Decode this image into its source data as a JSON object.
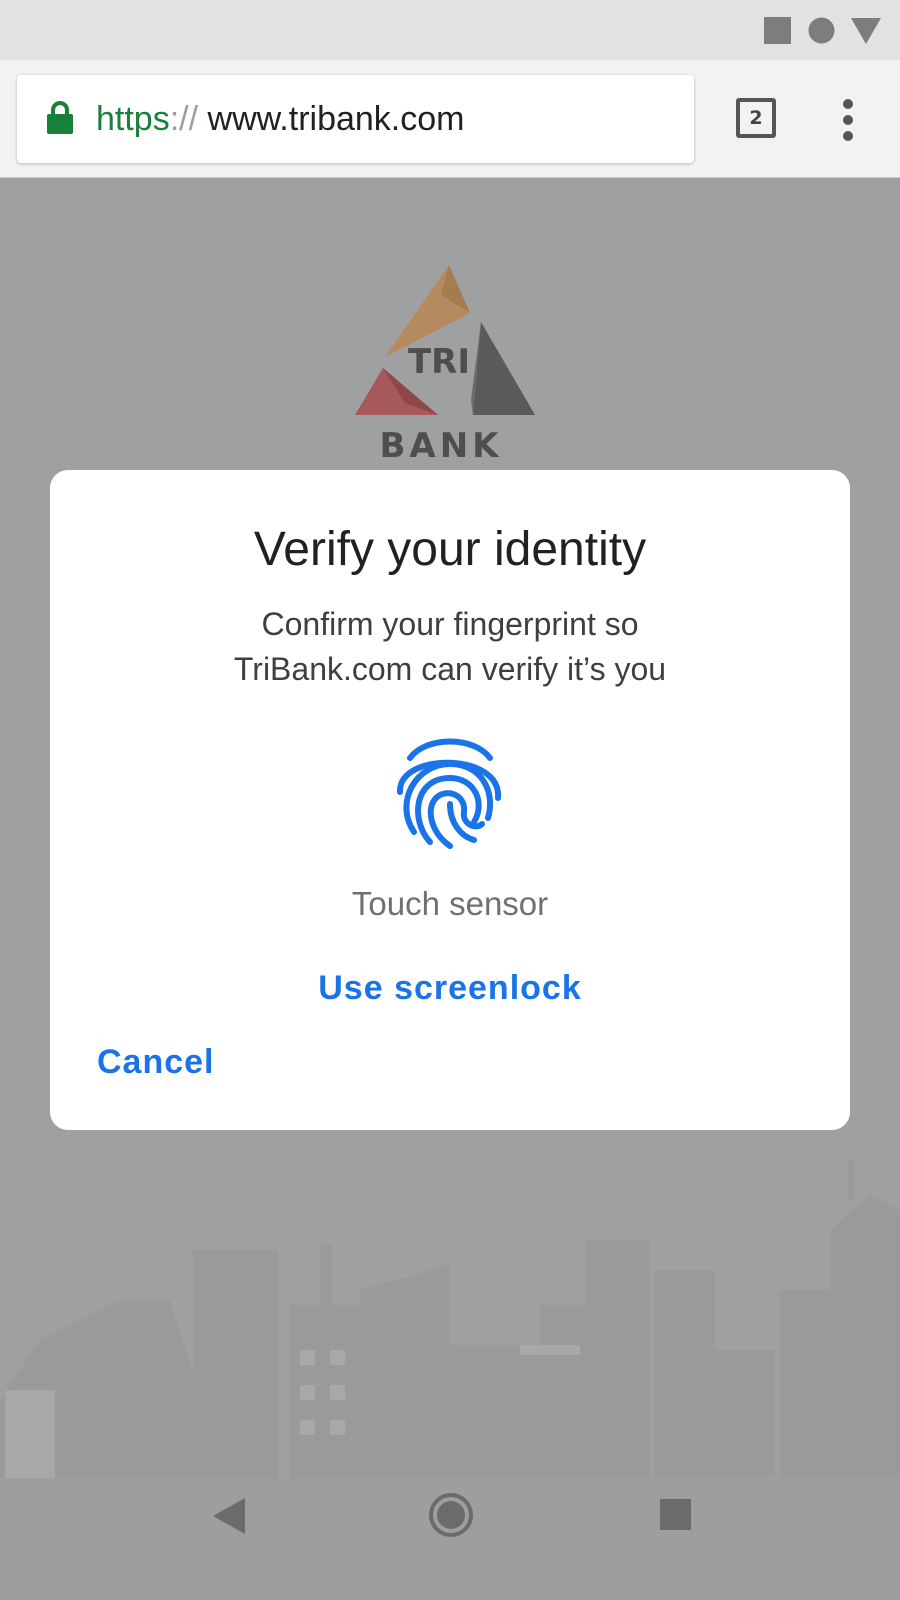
{
  "status_bar": {
    "icons": [
      "square-icon",
      "circle-icon",
      "triangle-icon"
    ]
  },
  "browser": {
    "url_scheme": "https",
    "url_separator": "://",
    "url_host": "www.tribank.com",
    "tab_count": "2",
    "icons": [
      "lock-icon",
      "tab-switcher-icon",
      "overflow-menu-icon"
    ]
  },
  "page": {
    "logo": {
      "top_text": "TRI",
      "bottom_text": "BANK"
    }
  },
  "dialog": {
    "title": "Verify your identity",
    "message_line1": "Confirm your fingerprint so",
    "message_line2": "TriBank.com can verify it’s you",
    "icon": "fingerprint-icon",
    "sensor_label": "Touch sensor",
    "use_screenlock_label": "Use screenlock",
    "cancel_label": "Cancel"
  },
  "nav_bar": {
    "icons": [
      "back-icon",
      "home-icon",
      "recents-icon"
    ]
  },
  "colors": {
    "accent": "#1a73e8",
    "secure": "#188038",
    "scrim_background": "#9fa0a2"
  }
}
